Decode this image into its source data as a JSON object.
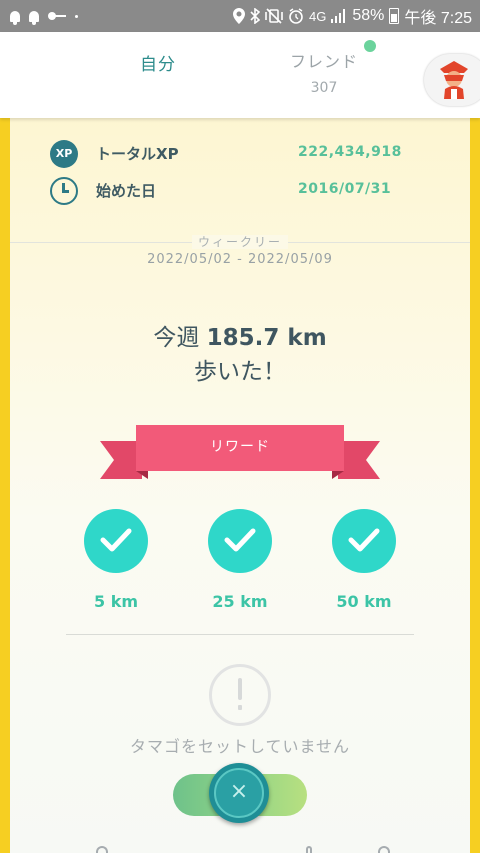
{
  "status_bar": {
    "battery": "58%",
    "time": "午後 7:25",
    "network": "4G"
  },
  "header": {
    "tab_self": "自分",
    "tab_friends": "フレンド",
    "friend_count": "307"
  },
  "stats": [
    {
      "icon": "xp-icon",
      "icon_text": "XP",
      "label": "トータルXP",
      "value": "222,434,918"
    },
    {
      "icon": "clock-icon",
      "label": "始めた日",
      "value": "2016/07/31"
    }
  ],
  "weekly": {
    "title": "ウィークリー",
    "range": "2022/05/02 - 2022/05/09",
    "walked_prefix": "今週 ",
    "walked_distance": "185.7 km",
    "walked_suffix": "歩いた！"
  },
  "rewards": {
    "title": "リワード",
    "milestones": [
      {
        "label": "5 km",
        "completed": true
      },
      {
        "label": "25 km",
        "completed": true
      },
      {
        "label": "50 km",
        "completed": true
      }
    ]
  },
  "egg": {
    "message": "タマゴをセットしていません"
  },
  "close_icon": "×",
  "colors": {
    "accent": "#2d8c8c",
    "ribbon": "#f25a79",
    "check": "#2fd7c9",
    "value_green": "#58c09a",
    "frame_yellow": "#f6cf22"
  }
}
